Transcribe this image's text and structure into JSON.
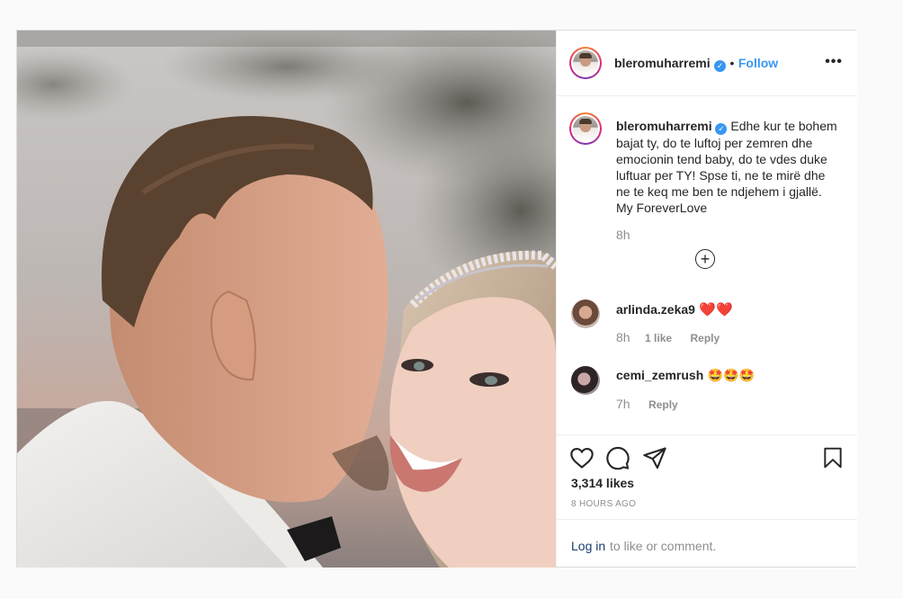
{
  "post": {
    "username": "bleromuharremi",
    "verified_badge": "✓",
    "separator": "•",
    "follow_label": "Follow",
    "more_icon": "•••",
    "caption": "Edhe kur te bohem bajat ty, do te luftoj per zemren dhe emocionin tend baby, do te vdes duke luftuar per TY! Spse ti, ne te mirë dhe ne te keq me ben te ndjehem i gjallë. My ForeverLove",
    "caption_time": "8h",
    "load_more_icon": "+",
    "comments": [
      {
        "username": "arlinda.zeka9",
        "text": "❤️❤️",
        "time": "8h",
        "likes": "1 like",
        "reply": "Reply"
      },
      {
        "username": "cemi_zemrush",
        "text": "🤩🤩🤩",
        "time": "7h",
        "reply": "Reply"
      }
    ],
    "likes": "3,314 likes",
    "posted_ago": "8 HOURS AGO",
    "login_link": "Log in",
    "login_rest": "to like or comment."
  },
  "icons": {
    "like": "heart-outline",
    "comment": "speech-bubble",
    "share": "paper-plane",
    "save": "bookmark"
  },
  "colors": {
    "accent": "#3897f0",
    "heart": "#e8102b",
    "muted": "#8e8e8e"
  }
}
